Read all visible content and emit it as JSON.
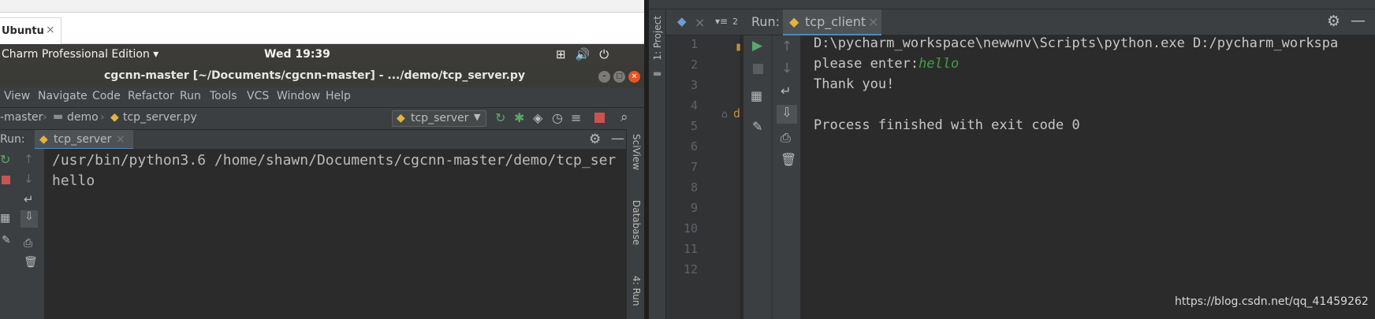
{
  "left_window": {
    "tab": {
      "label": "Ubuntu",
      "close": "×"
    },
    "top_bar": {
      "app_menu": "Charm Professional Edition ▾",
      "clock": "Wed 19:39"
    },
    "title": "cgcnn-master [~/Documents/cgcnn-master] - .../demo/tcp_server.py",
    "menu": [
      "View",
      "Navigate",
      "Code",
      "Refactor",
      "Run",
      "Tools",
      "VCS",
      "Window",
      "Help"
    ],
    "breadcrumb": {
      "project": "-master",
      "folder": "demo",
      "file": "tcp_server.py"
    },
    "run_config": "tcp_server",
    "run_label": "Run:",
    "run_tab": "tcp_server",
    "console_lines": [
      "/usr/bin/python3.6 /home/shawn/Documents/cgcnn-master/demo/tcp_ser",
      "hello"
    ],
    "side_panels": [
      "SciView",
      "Database",
      "4: Run"
    ]
  },
  "right_window": {
    "project_strip": "1: Project",
    "editor_tab_count": "2",
    "run_label": "Run:",
    "run_tab": "tcp_client",
    "line_numbers": [
      "1",
      "2",
      "3",
      "4",
      "5",
      "6",
      "7",
      "8",
      "9",
      "10",
      "11",
      "12"
    ],
    "console": {
      "line1": "D:\\pycharm_workspace\\newwnv\\Scripts\\python.exe D:/pycharm_workspa",
      "prompt": "please enter:",
      "input": "hello",
      "line3": "Thank you!",
      "line5": "Process finished with exit code 0"
    },
    "colors": {
      "input_text": "#42a142",
      "accent": "#4a88c7"
    }
  },
  "watermark": "https://blog.csdn.net/qq_41459262"
}
